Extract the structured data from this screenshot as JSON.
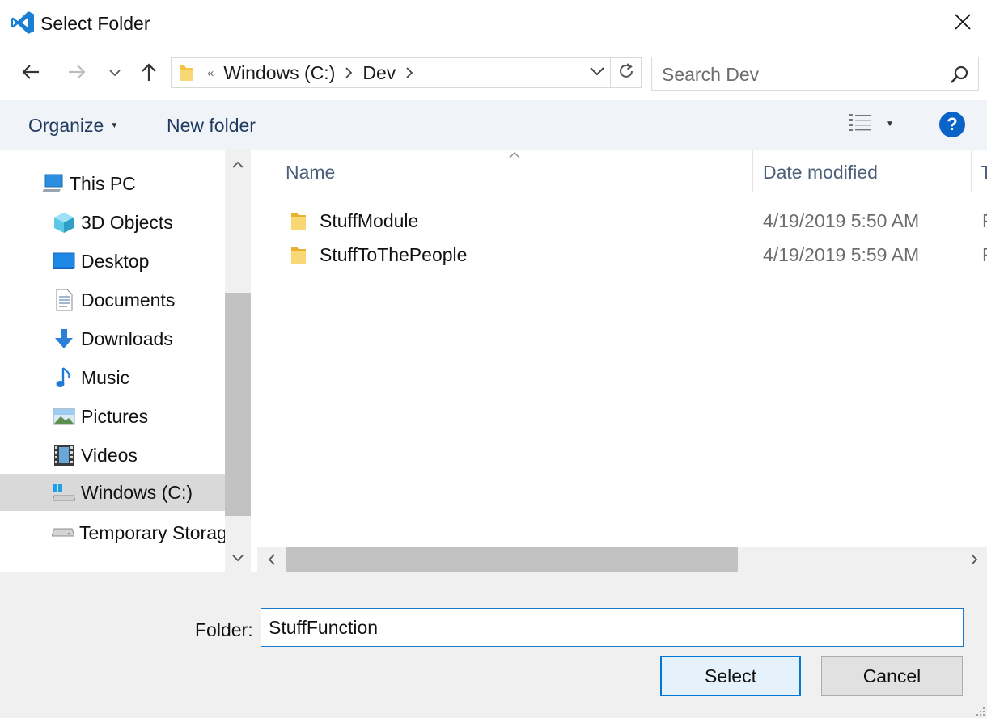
{
  "window": {
    "title": "Select Folder",
    "app_icon": "vscode-icon",
    "close_icon": "close-icon"
  },
  "navigation": {
    "back_icon": "back-arrow-icon",
    "forward_icon": "forward-arrow-icon",
    "recent_icon": "chevron-down-icon",
    "up_icon": "up-arrow-icon",
    "address": {
      "overflow": "«",
      "crumbs": [
        "Windows (C:)",
        "Dev"
      ],
      "dropdown_icon": "chevron-down-icon",
      "refresh_icon": "refresh-icon"
    },
    "search": {
      "placeholder": "Search Dev",
      "value": "",
      "icon": "search-icon"
    }
  },
  "commandbar": {
    "organize_label": "Organize",
    "new_folder_label": "New folder",
    "view_icon": "details-view-icon",
    "help_label": "?"
  },
  "sidebar": {
    "items": [
      {
        "label": "This PC",
        "icon": "computer-icon",
        "selected": false
      },
      {
        "label": "3D Objects",
        "icon": "cube-icon",
        "selected": false
      },
      {
        "label": "Desktop",
        "icon": "desktop-icon",
        "selected": false
      },
      {
        "label": "Documents",
        "icon": "document-icon",
        "selected": false
      },
      {
        "label": "Downloads",
        "icon": "download-icon",
        "selected": false
      },
      {
        "label": "Music",
        "icon": "music-icon",
        "selected": false
      },
      {
        "label": "Pictures",
        "icon": "pictures-icon",
        "selected": false
      },
      {
        "label": "Videos",
        "icon": "videos-icon",
        "selected": false
      },
      {
        "label": "Windows (C:)",
        "icon": "windows-drive-icon",
        "selected": true
      },
      {
        "label": "Temporary Storag",
        "icon": "drive-icon",
        "selected": false
      }
    ]
  },
  "filelist": {
    "columns": [
      "Name",
      "Date modified",
      "T"
    ],
    "rows": [
      {
        "name": "StuffModule",
        "date": "4/19/2019 5:50 AM",
        "type": "F"
      },
      {
        "name": "StuffToThePeople",
        "date": "4/19/2019 5:59 AM",
        "type": "F"
      }
    ]
  },
  "footer": {
    "folder_label": "Folder:",
    "folder_value": "StuffFunction",
    "select_label": "Select",
    "cancel_label": "Cancel"
  },
  "colors": {
    "accent": "#0078d7",
    "command_bar_bg": "#f0f3f8",
    "selected_bg": "#d9d9d9",
    "folder_yellow": "#f5c342"
  }
}
